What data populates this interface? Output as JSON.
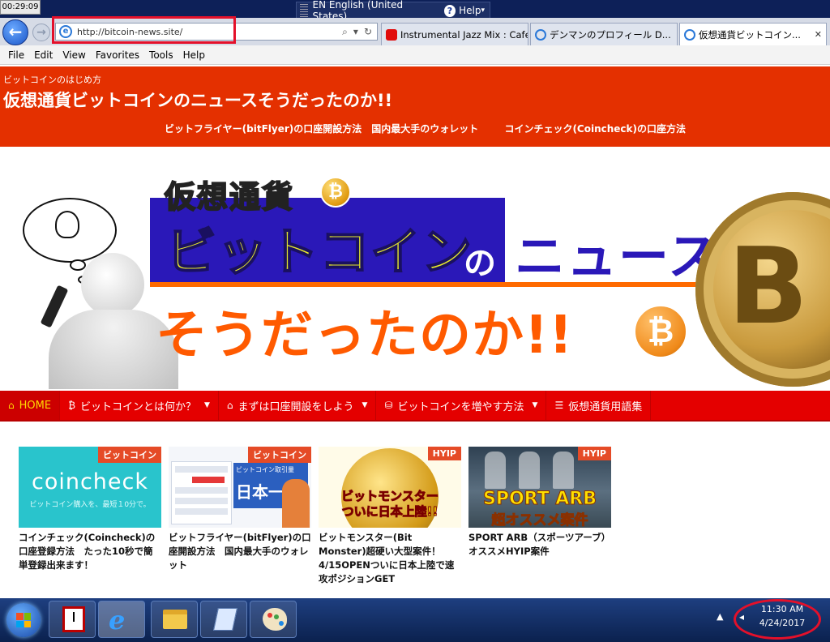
{
  "timer": "00:29:09",
  "language_bar": {
    "language": "EN English (United States)",
    "help": "Help"
  },
  "browser": {
    "address": "http://bitcoin-news.site/",
    "tabs": [
      {
        "label": "Instrumental Jazz Mix : Cafe...",
        "icon": "youtube-icon"
      },
      {
        "label": "デンマンのプロフィール D...",
        "icon": "ie-icon"
      },
      {
        "label": "仮想通貨ビットコイン...",
        "icon": "ie-icon",
        "active": true
      }
    ],
    "menu": [
      "File",
      "Edit",
      "View",
      "Favorites",
      "Tools",
      "Help"
    ]
  },
  "site": {
    "subtitle": "ビットコインのはじめ方",
    "title": "仮想通貨ビットコインのニュースそうだったのか!!",
    "header_links": [
      "ビットフライヤー(bitFlyer)の口座開設方法　国内最大手のウォレット",
      "コインチェック(Coincheck)の口座方法"
    ],
    "banner": {
      "line1": "仮想通貨",
      "line2": "ビットコイン",
      "connector": "の",
      "line3": "ニュース",
      "line4": "そうだったのか!!"
    },
    "nav": [
      {
        "label": "HOME",
        "icon": "home-icon"
      },
      {
        "label": "ビットコインとは何か？",
        "icon": "bitcoin-icon",
        "dropdown": true
      },
      {
        "label": "まずは口座開設をしよう",
        "icon": "bank-icon",
        "dropdown": true
      },
      {
        "label": "ビットコインを増やす方法",
        "icon": "coins-icon",
        "dropdown": true
      },
      {
        "label": "仮想通貨用語集",
        "icon": "list-icon"
      }
    ],
    "cards": [
      {
        "badge": "ビットコイン",
        "title": "コインチェック(Coincheck)の口座登録方法　たった10秒で簡単登録出来ます！",
        "thumb_logo": "coincheck",
        "thumb_tagline": "ビットコイン購入を、最短１0分で。"
      },
      {
        "badge": "ビットコイン",
        "title": "ビットフライヤー(bitFlyer)の口座開設方法　国内最大手のウォレット",
        "thumb_promo": "ビットコイン取引量",
        "thumb_promo_big": "日本一"
      },
      {
        "badge": "HYIP",
        "title": "ビットモンスター(Bit Monster)超硬い大型案件！4/15OPENついに日本上陸で速攻ポジションGET",
        "thumb_line1": "ビットモンスター",
        "thumb_line2": "ついに日本上陸!!"
      },
      {
        "badge": "HYIP",
        "title": "SPORT ARB（スポーツアーブ）オススメHYIP案件",
        "thumb_line1": "SPORT ARB",
        "thumb_line2": "超オススメ案件"
      }
    ]
  },
  "taskbar": {
    "time": "11:30 AM",
    "date": "4/24/2017"
  },
  "colors": {
    "header_red": "#e43000",
    "nav_red": "#e40000",
    "badge_orange": "#e54b27",
    "highlight_red": "#e4102a"
  }
}
